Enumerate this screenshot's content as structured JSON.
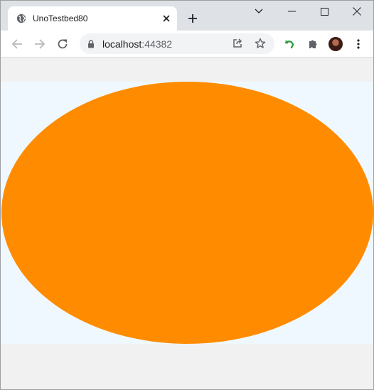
{
  "browser": {
    "tab": {
      "title": "UnoTestbed80"
    },
    "address": {
      "host": "localhost",
      "port": ":44382"
    }
  },
  "colors": {
    "tab_strip": "#dee1e6",
    "page_background": "#f1f1f1",
    "canvas_background": "#f0f8ff",
    "ellipse_fill": "#ff8c00"
  },
  "icons": {
    "favicon": "globe-icon",
    "extension_1": "green-arrow-icon",
    "extension_2": "puzzle-icon",
    "menu": "kebab-menu-icon"
  }
}
